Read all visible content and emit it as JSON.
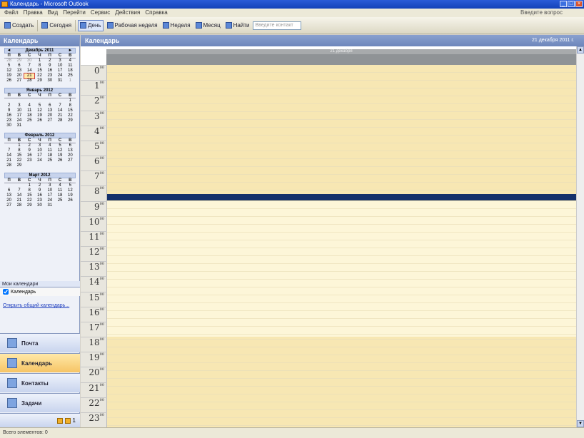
{
  "window": {
    "title": "Календарь - Microsoft Outlook"
  },
  "menu": {
    "items": [
      "Файл",
      "Правка",
      "Вид",
      "Перейти",
      "Сервис",
      "Действия",
      "Справка"
    ],
    "help_box": "Введите вопрос"
  },
  "toolbar": {
    "items": [
      {
        "label": "Создать",
        "selected": false
      },
      {
        "label": "Сегодня",
        "selected": false
      },
      {
        "label": "День",
        "selected": true
      },
      {
        "label": "Рабочая неделя",
        "selected": false
      },
      {
        "label": "Неделя",
        "selected": false
      },
      {
        "label": "Месяц",
        "selected": false
      },
      {
        "label": "Найти",
        "selected": false
      }
    ],
    "search_placeholder": "Введите контакт"
  },
  "nav": {
    "header": "Календарь",
    "day_names": [
      "П",
      "В",
      "С",
      "Ч",
      "П",
      "С",
      "В"
    ],
    "months": [
      {
        "title": "Декабрь 2011",
        "days": [
          "28",
          "29",
          "30",
          "1",
          "2",
          "3",
          "4",
          "5",
          "6",
          "7",
          "8",
          "9",
          "10",
          "11",
          "12",
          "13",
          "14",
          "15",
          "16",
          "17",
          "18",
          "19",
          "20",
          "21",
          "22",
          "23",
          "24",
          "25",
          "26",
          "27",
          "28",
          "29",
          "30",
          "31",
          "1"
        ],
        "today": "21"
      },
      {
        "title": "Январь 2012",
        "days": [
          "",
          "",
          "",
          "",
          "",
          "",
          "1",
          "2",
          "3",
          "4",
          "5",
          "6",
          "7",
          "8",
          "9",
          "10",
          "11",
          "12",
          "13",
          "14",
          "15",
          "16",
          "17",
          "18",
          "19",
          "20",
          "21",
          "22",
          "23",
          "24",
          "25",
          "26",
          "27",
          "28",
          "29",
          "30",
          "31"
        ],
        "today": ""
      },
      {
        "title": "Февраль 2012",
        "days": [
          "",
          "1",
          "2",
          "3",
          "4",
          "5",
          "6",
          "7",
          "8",
          "9",
          "10",
          "11",
          "12",
          "13",
          "14",
          "15",
          "16",
          "17",
          "18",
          "19",
          "20",
          "21",
          "22",
          "23",
          "24",
          "25",
          "26",
          "27",
          "28",
          "29"
        ],
        "today": ""
      },
      {
        "title": "Март 2012",
        "days": [
          "",
          "",
          "1",
          "2",
          "3",
          "4",
          "5",
          "6",
          "7",
          "8",
          "9",
          "10",
          "11",
          "12",
          "13",
          "14",
          "15",
          "16",
          "17",
          "18",
          "19",
          "20",
          "21",
          "22",
          "23",
          "24",
          "25",
          "26",
          "27",
          "28",
          "29",
          "30",
          "31"
        ],
        "today": ""
      }
    ],
    "my_calendars_header": "Мои календари",
    "calendar_item": "Календарь",
    "open_shared_link": "Открыть общий календарь...",
    "buttons": [
      "Почта",
      "Календарь",
      "Контакты",
      "Задачи"
    ],
    "selected_button": "Календарь",
    "footer_count": "1"
  },
  "main": {
    "header": "Календарь",
    "date": "21 декабря 2011 г.",
    "day_label": "21 декабря",
    "hours": [
      "0",
      "1",
      "2",
      "3",
      "4",
      "5",
      "6",
      "7",
      "8",
      "9",
      "10",
      "11",
      "12",
      "13",
      "14",
      "15",
      "16",
      "17",
      "18",
      "19",
      "20",
      "21",
      "22",
      "23"
    ],
    "minutes_suffix": "00",
    "work_start_hour": 9,
    "work_end_hour": 18,
    "current_time_hour": 9
  },
  "status": {
    "text": "Всего элементов: 0"
  },
  "colors": {
    "header_blue": "#6d86bb",
    "now_line": "#14306b",
    "work_yellow": "#fdf6d8",
    "off_yellow": "#f7e7b3"
  }
}
